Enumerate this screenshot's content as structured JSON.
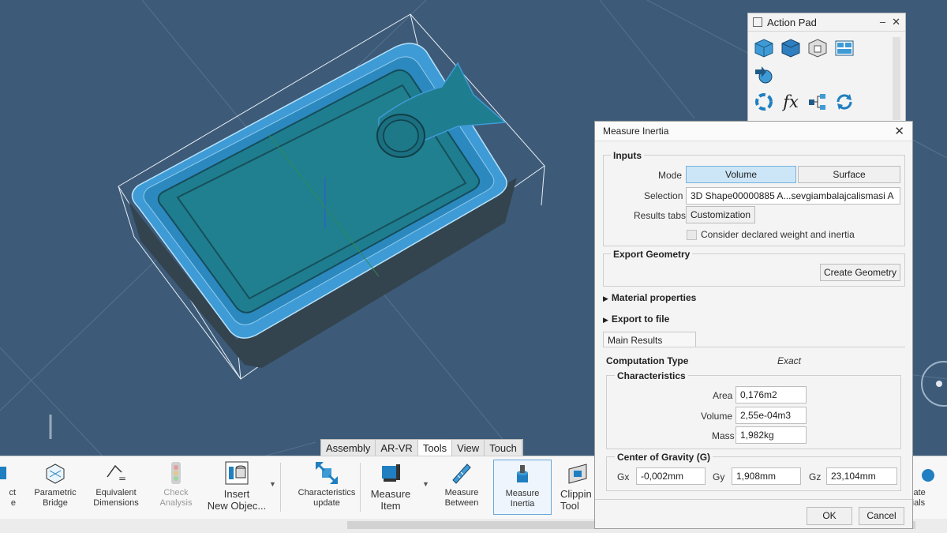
{
  "action_pad": {
    "title": "Action Pad",
    "controls": [
      "–",
      "✕"
    ],
    "icons": [
      "part-body-icon",
      "solid-body-icon",
      "shell-icon",
      "layout-icon",
      "insert-arrow-icon",
      "rotate-icon",
      "formula-icon",
      "tree-icon",
      "refresh-icon"
    ],
    "formula_glyph": "fx"
  },
  "ribbon": {
    "tabs": [
      "Assembly",
      "AR-VR",
      "Tools",
      "View",
      "Touch"
    ],
    "active_tab": "Tools",
    "buttons": [
      {
        "label": "ct\ne",
        "icon": "truncated-icon"
      },
      {
        "label": "Parametric\nBridge",
        "icon": "parametric-bridge-icon"
      },
      {
        "label": "Equivalent\nDimensions",
        "icon": "equivalent-dimensions-icon"
      },
      {
        "label": "Check\nAnalysis",
        "icon": "traffic-light-icon"
      },
      {
        "label": "Insert\nNew Objec...",
        "icon": "insert-object-icon"
      },
      {
        "label": "Characteristics\nupdate",
        "icon": "characteristics-update-icon"
      },
      {
        "label": "Measure\nItem",
        "icon": "measure-item-icon"
      },
      {
        "label": "Measure\nBetween",
        "icon": "measure-between-icon"
      },
      {
        "label": "Measure\nInertia",
        "icon": "measure-inertia-icon"
      },
      {
        "label": "Clippin\nTool",
        "icon": "clipping-tool-icon"
      },
      {
        "label": "cate\nrials",
        "icon": "materials-icon"
      }
    ]
  },
  "dialog": {
    "title": "Measure Inertia",
    "inputs": {
      "label": "Inputs",
      "mode_label": "Mode",
      "mode_options": [
        "Volume",
        "Surface"
      ],
      "mode_selected": "Volume",
      "selection_label": "Selection",
      "selection_value": "3D Shape00000885 A...sevgiambalajcalismasi A",
      "results_tabs_label": "Results tabs",
      "customization_button": "Customization",
      "consider_label": "Consider declared weight and inertia",
      "consider_checked": false
    },
    "export_geometry": {
      "label": "Export Geometry",
      "create_button": "Create Geometry"
    },
    "material_properties": "Material properties",
    "export_to_file": "Export to file",
    "main_results_tab": "Main Results",
    "computation_type_label": "Computation Type",
    "computation_type_value": "Exact",
    "characteristics": {
      "label": "Characteristics",
      "area_label": "Area",
      "area_value": "0,176m2",
      "volume_label": "Volume",
      "volume_value": "2,55e-04m3",
      "mass_label": "Mass",
      "mass_value": "1,982kg"
    },
    "center_of_gravity": {
      "label": "Center of Gravity (G)",
      "gx_label": "Gx",
      "gx_value": "-0,002mm",
      "gy_label": "Gy",
      "gy_value": "1,908mm",
      "gz_label": "Gz",
      "gz_value": "23,104mm"
    },
    "ok_button": "OK",
    "cancel_button": "Cancel"
  },
  "colors": {
    "background": "#3d5b78",
    "part_teal": "#1f7d90",
    "part_rim": "#3e9ed6",
    "selection_highlight": "#cde6f7"
  }
}
